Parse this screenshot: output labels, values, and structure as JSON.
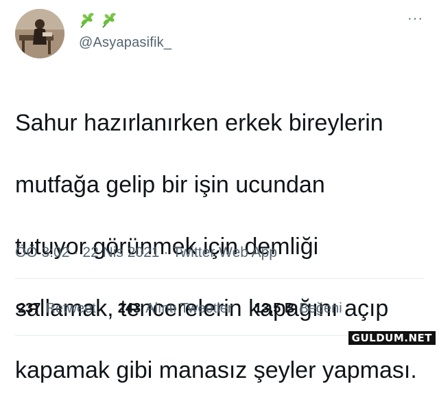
{
  "user": {
    "handle": "@Asyapasifik_",
    "display_name_icons": [
      "herb-icon",
      "herb-icon"
    ]
  },
  "tweet": {
    "text_lines": [
      "Sahur hazırlanırken erkek bireylerin",
      "mutfağa gelip bir işin ucundan",
      "tutuyor görünmek için demliği",
      "sallamak, tencerelerin kapağını açıp",
      "kapamak gibi manasız şeyler yapması."
    ],
    "time": "ÖÖ 3:02",
    "sep1": "·",
    "date": "22 Nis 2021",
    "sep2": "·",
    "source": "Twitter Web App"
  },
  "stats": {
    "retweets": {
      "count": "237",
      "label": "Retweet"
    },
    "quotes": {
      "count": "243",
      "label": "Alıntı Tweetler"
    },
    "likes": {
      "count": "13,5 B",
      "label": "Beğeni"
    }
  },
  "more_label": "···",
  "watermark": "GULDUM.NET",
  "colors": {
    "text": "#0f1419",
    "secondary": "#536471",
    "divider": "#e6ecf0",
    "herb": "#6bbf3a"
  }
}
